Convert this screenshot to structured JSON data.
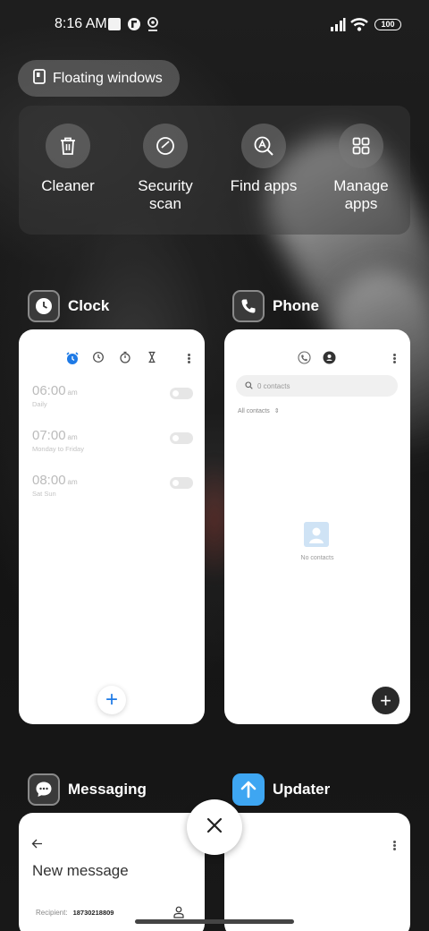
{
  "status_bar": {
    "time": "8:16 AM",
    "battery": "100"
  },
  "floating_windows": {
    "label": "Floating windows"
  },
  "quick_actions": [
    {
      "label": "Cleaner",
      "icon": "trash-icon"
    },
    {
      "label": "Security scan",
      "icon": "security-check-icon"
    },
    {
      "label": "Find apps",
      "icon": "find-apps-icon"
    },
    {
      "label": "Manage apps",
      "icon": "grid-icon"
    }
  ],
  "apps": {
    "clock": {
      "name": "Clock",
      "alarms": [
        {
          "time": "06:00",
          "ampm": "am",
          "days": "Daily"
        },
        {
          "time": "07:00",
          "ampm": "am",
          "days": "Monday to Friday"
        },
        {
          "time": "08:00",
          "ampm": "am",
          "days": "Sat Sun"
        }
      ]
    },
    "phone": {
      "name": "Phone",
      "search_placeholder": "0 contacts",
      "filter_label": "All contacts",
      "empty_label": "No contacts"
    },
    "messaging": {
      "name": "Messaging",
      "title": "New message",
      "recipient_label": "Recipient:",
      "recipient_value": "18730218809"
    },
    "updater": {
      "name": "Updater"
    }
  },
  "colors": {
    "accent_blue": "#1e7ae6",
    "updater_blue": "#3ea6f2",
    "card_bg": "#ffffff"
  }
}
